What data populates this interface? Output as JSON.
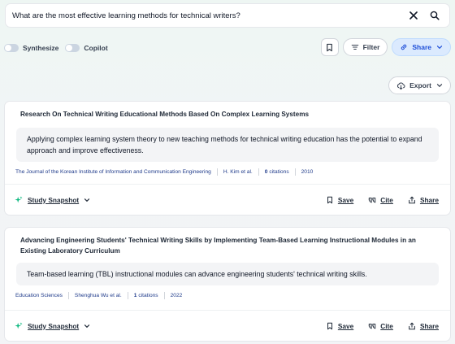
{
  "search": {
    "query": "What are the most effective learning methods for technical writers?"
  },
  "controls": {
    "synthesize_label": "Synthesize",
    "copilot_label": "Copilot",
    "filter_label": "Filter",
    "share_label": "Share",
    "export_label": "Export"
  },
  "results": [
    {
      "title": "Research On Technical Writing Educational Methods Based On Complex Learning Systems",
      "summary": "Applying complex learning system theory to new teaching methods for technical writing education has the potential to expand approach and improve effectiveness.",
      "journal": "The Journal of the Korean Institute of Information and Communication Engineering",
      "authors": "H. Kim et al.",
      "citations_count": "0",
      "citations_label": "citations",
      "year": "2010",
      "snapshot_label": "Study Snapshot",
      "save_label": "Save",
      "cite_label": "Cite",
      "share_label": "Share"
    },
    {
      "title": "Advancing Engineering Students' Technical Writing Skills by Implementing Team-Based Learning Instructional Modules in an Existing Laboratory Curriculum",
      "summary": "Team-based learning (TBL) instructional modules can advance engineering students' technical writing skills.",
      "journal": "Education Sciences",
      "authors": "Shenghua Wu et al.",
      "citations_count": "1",
      "citations_label": "citations",
      "year": "2022",
      "snapshot_label": "Study Snapshot",
      "save_label": "Save",
      "cite_label": "Cite",
      "share_label": "Share"
    }
  ],
  "colors": {
    "accent": "#1d4ed8",
    "share_bg": "#dbeafe",
    "snapshot_sparkle": "#10b981"
  }
}
